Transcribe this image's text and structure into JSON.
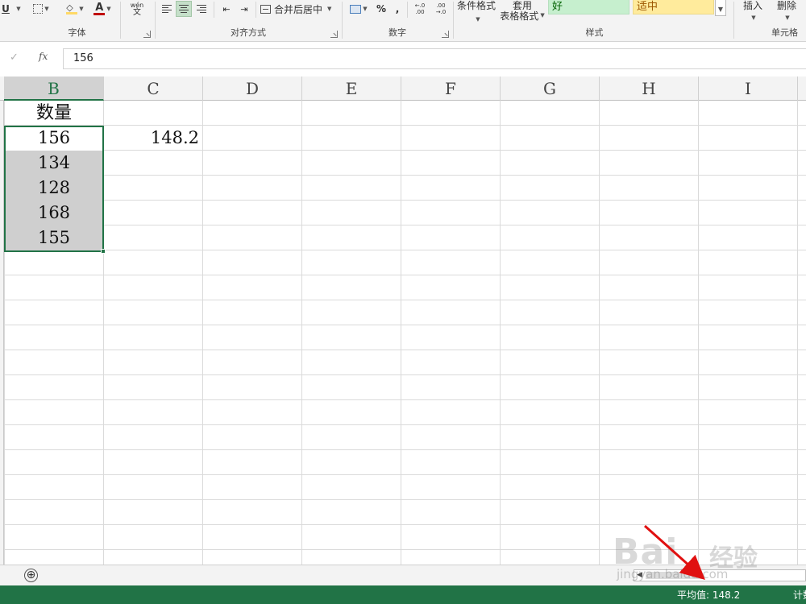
{
  "ribbon": {
    "font_group_label": "字体",
    "align_group_label": "对齐方式",
    "number_group_label": "数字",
    "styles_group_label": "样式",
    "cells_group_label": "单元格",
    "underline_label": "U",
    "phonetic_label": "wén",
    "phonetic_char": "文",
    "merge_center_label": "合并后居中",
    "percent_label": "%",
    "comma_label": ",",
    "inc_decimal_label": "←.0 .00",
    "dec_decimal_label": ".00 →.0",
    "conditional_format_label": "条件格式",
    "table_format_line1": "套用",
    "table_format_line2": "表格格式",
    "style_good": "好",
    "style_neutral": "适中",
    "insert_label": "插入",
    "delete_label": "删除",
    "accent_color": "#217346",
    "font_color_bar": "#c00000",
    "fill_color_bar": "#ffd966"
  },
  "formula_bar": {
    "cancel_icon": "✓",
    "fx_label": "fx",
    "content": "156"
  },
  "grid": {
    "columns": [
      "B",
      "C",
      "D",
      "E",
      "F",
      "G",
      "H",
      "I"
    ],
    "selected_column": "B",
    "header_cell": "数量",
    "values": [
      "156",
      "134",
      "128",
      "168",
      "155"
    ],
    "average_result": "148.2"
  },
  "tabs": {
    "add_sheet_icon": "⊕"
  },
  "status": {
    "average_text": "平均值: 148.2",
    "count_text": "计数"
  },
  "watermark": {
    "logo": "Bai",
    "logo_suffix": "经验",
    "url": "jingyan.baidu.com"
  }
}
